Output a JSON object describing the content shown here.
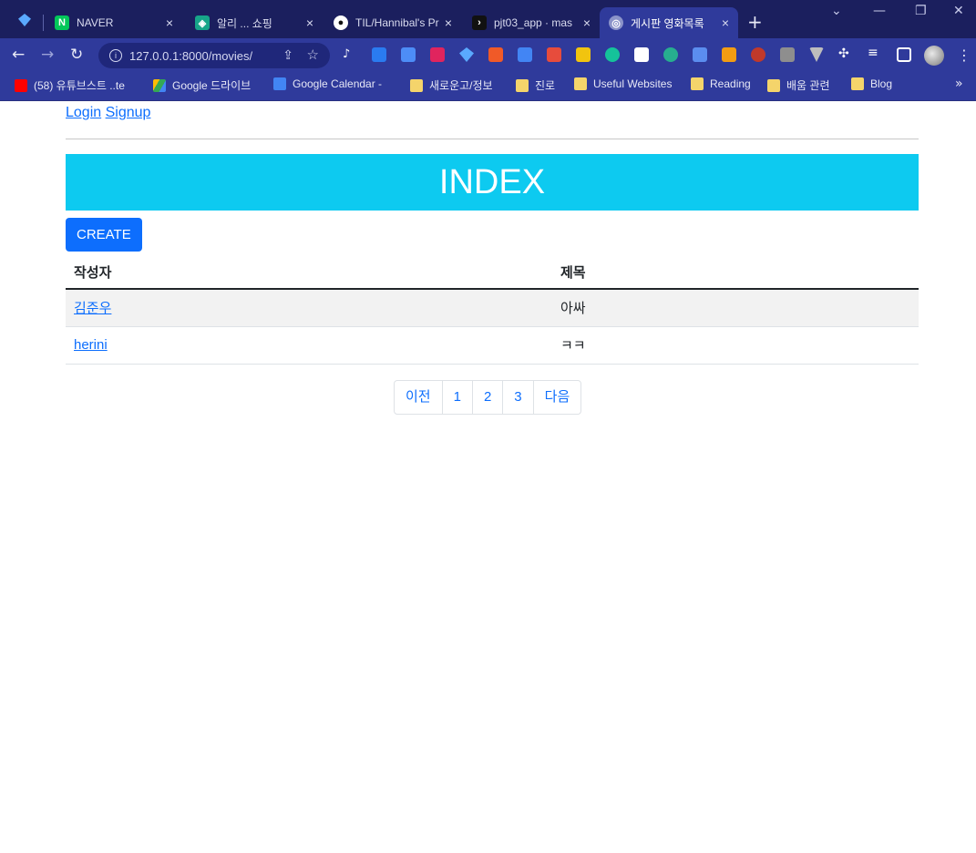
{
  "browser": {
    "tabs": [
      {
        "title": "NAVER",
        "favicon": "naver-icon",
        "color": "#03c75a"
      },
      {
        "title": "알리 ... 쇼핑",
        "favicon": "ali-icon",
        "color": "#17a589"
      },
      {
        "title": "TIL/Hannibal's Pro",
        "favicon": "github-icon",
        "color": "#111111"
      },
      {
        "title": "pjt03_app · mas",
        "favicon": "terminal-icon",
        "color": "#111111"
      },
      {
        "title": "게시판 영화목록",
        "favicon": "globe-icon",
        "color": "#8b93c9"
      }
    ],
    "address": "127.0.0.1:8000/movies/",
    "bookmarks": [
      {
        "label": "(58) 유튜브스트 ..te",
        "icon": "youtube-icon",
        "color": "#ff0000"
      },
      {
        "label": "Google 드라이브",
        "icon": "drive-icon",
        "color": "#fbbc04"
      },
      {
        "label": "Google Calendar -",
        "icon": "calendar-icon",
        "color": "#4285f4"
      },
      {
        "label": "새로운고/정보",
        "icon": "folder-icon",
        "color": "#f4d46b"
      },
      {
        "label": "진로",
        "icon": "folder-icon",
        "color": "#f4d46b"
      },
      {
        "label": "Useful Websites",
        "icon": "folder-icon",
        "color": "#f4d46b"
      },
      {
        "label": "Reading",
        "icon": "folder-icon",
        "color": "#f4d46b"
      },
      {
        "label": "배움 관련",
        "icon": "folder-icon",
        "color": "#f4d46b"
      },
      {
        "label": "Blog",
        "icon": "folder-icon",
        "color": "#f4d46b"
      }
    ]
  },
  "nav": {
    "login": "Login",
    "signup": "Signup"
  },
  "hero": {
    "title": "INDEX"
  },
  "create_label": "CREATE",
  "table": {
    "headers": [
      "작성자",
      "제목"
    ],
    "rows": [
      {
        "author": "김준우",
        "title": "아싸"
      },
      {
        "author": "herini",
        "title": "ㅋㅋ"
      }
    ]
  },
  "pagination": {
    "prev": "이전",
    "pages": [
      "1",
      "2",
      "3"
    ],
    "next": "다음"
  },
  "colors": {
    "hero": "#0dcaf0",
    "primary": "#0d6efd",
    "chrome": "#2f3a9b"
  }
}
